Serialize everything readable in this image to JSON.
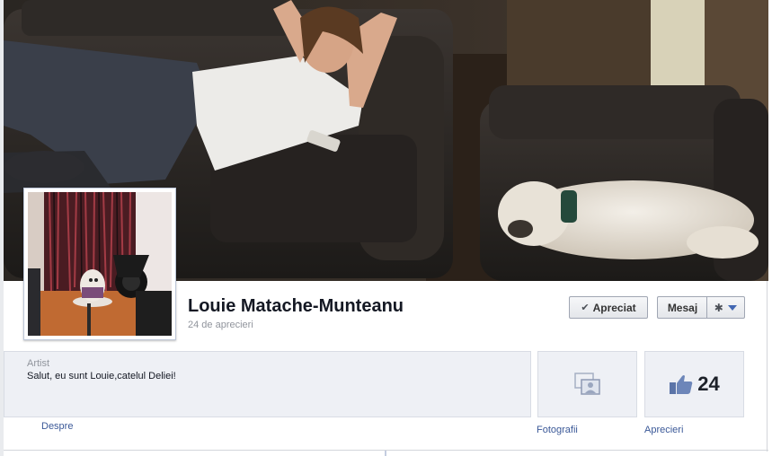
{
  "page": {
    "name": "Louie Matache-Munteanu",
    "likes_line": "24 de aprecieri"
  },
  "actions": {
    "liked_label": "Apreciat",
    "message_label": "Mesaj"
  },
  "about": {
    "category": "Artist",
    "description": "Salut, eu sunt Louie,catelul Deliei!",
    "link_label": "Despre"
  },
  "photos": {
    "link_label": "Fotografii"
  },
  "likes": {
    "count": "24",
    "link_label": "Aprecieri"
  },
  "icons": {
    "liked": "check-icon",
    "actions": "gear-icon",
    "dropdown": "caret-down-icon",
    "photos": "photo-stack-icon",
    "likes": "thumbs-up-icon"
  },
  "colors": {
    "link": "#3b5998",
    "name": "#141823",
    "panel_bg": "#eef0f5",
    "border": "#d8dce4"
  }
}
